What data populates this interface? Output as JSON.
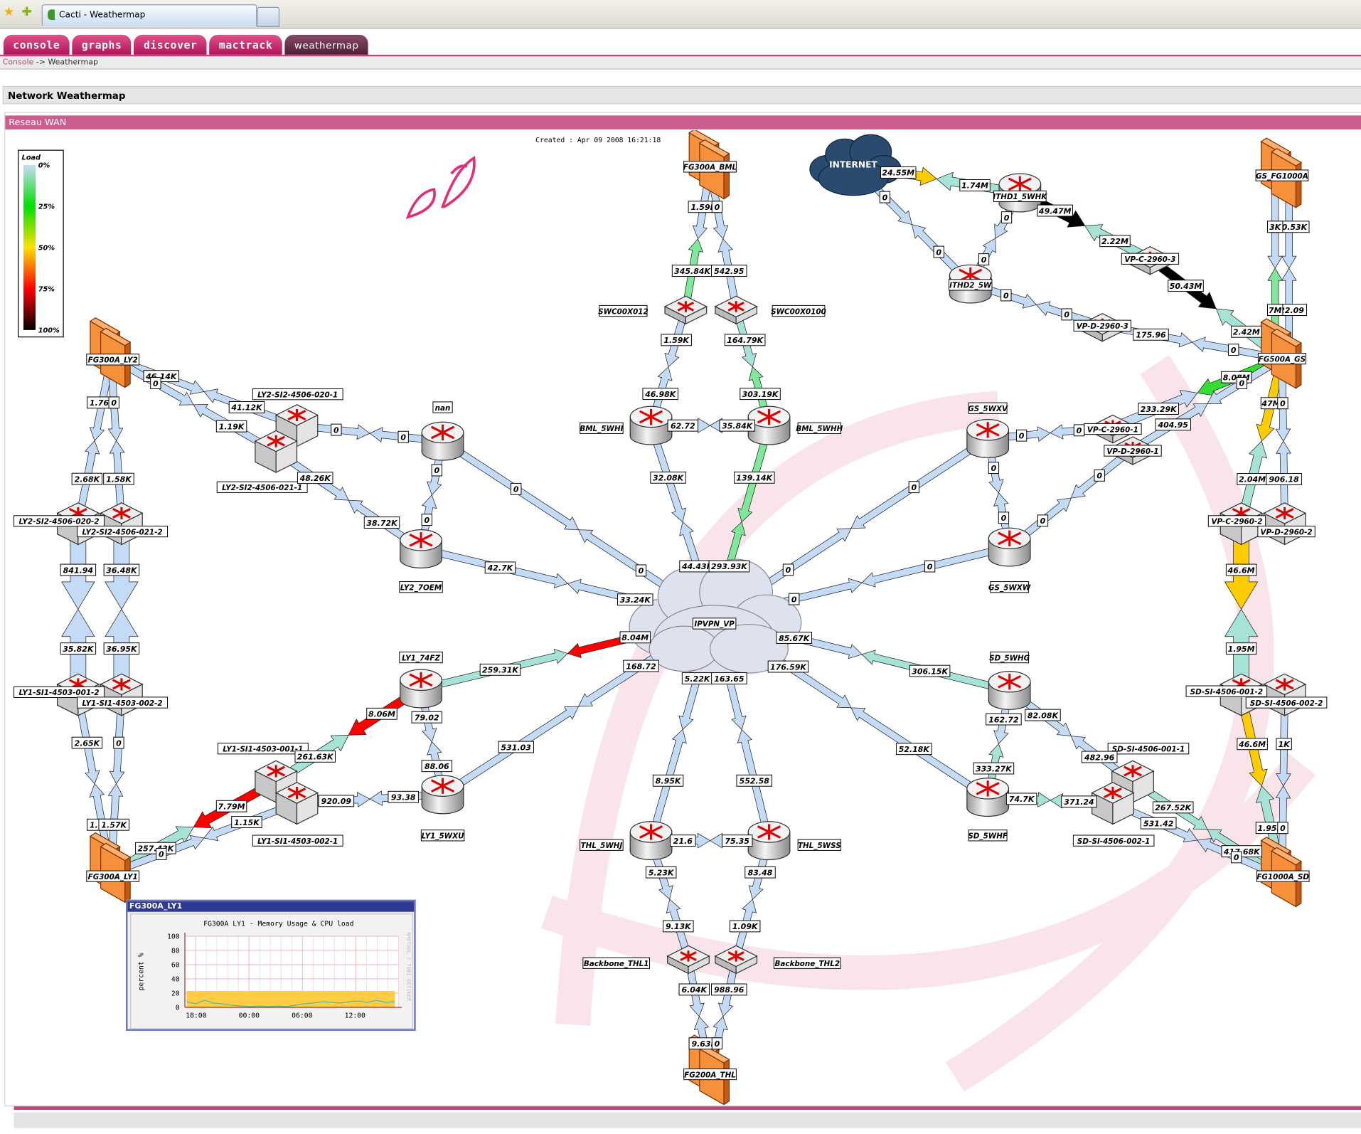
{
  "browser": {
    "tab_title": "Cacti - Weathermap"
  },
  "nav": {
    "tabs": [
      {
        "label": "console"
      },
      {
        "label": "graphs"
      },
      {
        "label": "discover"
      },
      {
        "label": "mactrack"
      },
      {
        "label": "weathermap",
        "active": true
      }
    ]
  },
  "breadcrumb": {
    "root": "Console",
    "separator": " -> ",
    "current": "Weathermap"
  },
  "page": {
    "title": "Network Weathermap",
    "map_title": "Reseau WAN"
  },
  "map": {
    "created": "Created : Apr 09 2008 16:21:18",
    "legend": {
      "title": "Load",
      "stops": [
        "0%",
        "25%",
        "50%",
        "75%",
        "100%"
      ],
      "colors": [
        "#c8dcf8",
        "#00e000",
        "#ffe000",
        "#ff0000",
        "#000000"
      ]
    },
    "colors": {
      "idle": "#c4dbf7",
      "low": "#a6e3d6",
      "green": "#7fe89a",
      "bright_green": "#33dd33",
      "yellow": "#ffcc00",
      "red": "#ff0000",
      "black": "#000000"
    },
    "nodes": [
      {
        "id": "FG300A_BML",
        "type": "firewall"
      },
      {
        "id": "INTERNET",
        "type": "internet"
      },
      {
        "id": "ITHD1_5WHK",
        "type": "router"
      },
      {
        "id": "ITHD2_5W",
        "type": "router"
      },
      {
        "id": "VP-C-2960-3",
        "type": "flatswitch"
      },
      {
        "id": "VP-D-2960-3",
        "type": "flatswitch"
      },
      {
        "id": "GS_FG1000A",
        "type": "firewall"
      },
      {
        "id": "FG500A_GS",
        "type": "firewall"
      },
      {
        "id": "SWC00X012",
        "type": "flatswitch"
      },
      {
        "id": "SWC00X0100",
        "type": "flatswitch"
      },
      {
        "id": "BML_5WHI",
        "type": "router"
      },
      {
        "id": "BML_5WHH",
        "type": "router"
      },
      {
        "id": "GS_5WXV",
        "type": "router"
      },
      {
        "id": "GS_5WXW",
        "type": "router"
      },
      {
        "id": "VP-C-2960-1",
        "type": "flatswitch"
      },
      {
        "id": "VP-D-2960-1",
        "type": "flatswitch"
      },
      {
        "id": "VP-C-2960-2",
        "type": "switch"
      },
      {
        "id": "VP-D-2960-2",
        "type": "switch"
      },
      {
        "id": "IPVPN_VP",
        "type": "cloud"
      },
      {
        "id": "nan",
        "type": "router"
      },
      {
        "id": "LY2_7OEM",
        "type": "router"
      },
      {
        "id": "LY2-SI2-4506-020-1",
        "type": "switch"
      },
      {
        "id": "LY2-SI2-4506-021-1",
        "type": "switch"
      },
      {
        "id": "FG300A_LY2",
        "type": "firewall"
      },
      {
        "id": "LY2-SI2-4506-020-2",
        "type": "switch"
      },
      {
        "id": "LY2-SI2-4506-021-2",
        "type": "switch"
      },
      {
        "id": "LY1-SI1-4503-001-2",
        "type": "switch"
      },
      {
        "id": "LY1-SI1-4503-002-2",
        "type": "switch"
      },
      {
        "id": "FG300A_LY1",
        "type": "firewall"
      },
      {
        "id": "LY1_74FZ",
        "type": "router"
      },
      {
        "id": "LY1_5WXU",
        "type": "router"
      },
      {
        "id": "LY1-SI1-4503-001-1",
        "type": "switch"
      },
      {
        "id": "LY1-SI1-4503-002-1",
        "type": "switch"
      },
      {
        "id": "THL_5WHJ",
        "type": "router"
      },
      {
        "id": "THL_5WSS",
        "type": "router"
      },
      {
        "id": "Backbone_THL1",
        "type": "flatswitch"
      },
      {
        "id": "Backbone_THL2",
        "type": "flatswitch"
      },
      {
        "id": "FG200A_THL",
        "type": "firewall"
      },
      {
        "id": "SD_5WHG",
        "type": "router"
      },
      {
        "id": "SD_5WHF",
        "type": "router"
      },
      {
        "id": "SD-SI-4506-001-1",
        "type": "switch"
      },
      {
        "id": "SD-SI-4506-002-1",
        "type": "switch"
      },
      {
        "id": "SD-SI-4506-001-2",
        "type": "switch"
      },
      {
        "id": "SD-SI-4506-002-2",
        "type": "switch"
      },
      {
        "id": "FG1000A_SD",
        "type": "firewall"
      }
    ],
    "links": [
      {
        "a": "FG300A_BML",
        "b": "SWC00X012",
        "la": "1.59K",
        "lb": "345.84K",
        "ca": "idle",
        "cb": "green"
      },
      {
        "a": "FG300A_BML",
        "b": "SWC00X0100",
        "la": "0",
        "lb": "542.95",
        "ca": "idle",
        "cb": "idle"
      },
      {
        "a": "SWC00X012",
        "b": "BML_5WHI",
        "la": "1.59K",
        "lb": "46.98K",
        "ca": "idle",
        "cb": "idle"
      },
      {
        "a": "SWC00X0100",
        "b": "BML_5WHH",
        "la": "164.79K",
        "lb": "303.19K",
        "ca": "low",
        "cb": "green"
      },
      {
        "a": "BML_5WHI",
        "b": "BML_5WHH",
        "la": "62.72",
        "lb": "35.84K",
        "ca": "idle",
        "cb": "idle"
      },
      {
        "a": "BML_5WHI",
        "b": "IPVPN_VP",
        "la": "32.08K",
        "lb": "44.43K",
        "ca": "idle",
        "cb": "idle"
      },
      {
        "a": "BML_5WHH",
        "b": "IPVPN_VP",
        "la": "139.14K",
        "lb": "293.93K",
        "ca": "green",
        "cb": "green"
      },
      {
        "a": "INTERNET",
        "b": "ITHD1_5WHK",
        "la": "24.55M",
        "lb": "1.74M",
        "ca": "yellow",
        "cb": "low"
      },
      {
        "a": "INTERNET",
        "b": "ITHD2_5W",
        "la": "0",
        "lb": "0",
        "ca": "idle",
        "cb": "idle"
      },
      {
        "a": "ITHD1_5WHK",
        "b": "ITHD2_5W",
        "la": "0",
        "lb": "0",
        "ca": "idle",
        "cb": "idle"
      },
      {
        "a": "ITHD1_5WHK",
        "b": "VP-C-2960-3",
        "la": "49.47M",
        "lb": "2.22M",
        "ca": "black",
        "cb": "low"
      },
      {
        "a": "VP-C-2960-3",
        "b": "FG500A_GS",
        "la": "50.43M",
        "lb": "2.42M",
        "ca": "black",
        "cb": "low"
      },
      {
        "a": "ITHD2_5W",
        "b": "VP-D-2960-3",
        "la": "0",
        "lb": "0",
        "ca": "idle",
        "cb": "idle"
      },
      {
        "a": "VP-D-2960-3",
        "b": "FG500A_GS",
        "la": "175.96",
        "lb": "0",
        "ca": "idle",
        "cb": "idle"
      },
      {
        "a": "GS_FG1000A",
        "b": "FG500A_GS",
        "la": "200.53K",
        "lb": "522.09",
        "ca": "idle",
        "cb": "idle",
        "lane": -1
      },
      {
        "a": "GS_FG1000A",
        "b": "FG500A_GS",
        "la": "3K",
        "lb": "7M",
        "ca": "idle",
        "cb": "green",
        "lane": 1
      },
      {
        "a": "FG500A_GS",
        "b": "VP-C-2960-1",
        "la": "8.08M",
        "lb": "233.29K",
        "ca": "bright_green",
        "cb": "idle"
      },
      {
        "a": "FG500A_GS",
        "b": "VP-D-2960-1",
        "la": "0",
        "lb": "404.95",
        "ca": "idle",
        "cb": "idle"
      },
      {
        "a": "GS_5WXV",
        "b": "VP-C-2960-1",
        "la": "0",
        "lb": "0",
        "ca": "idle",
        "cb": "idle"
      },
      {
        "a": "GS_5WXV",
        "b": "GS_5WXW",
        "la": "0",
        "lb": "0",
        "ca": "idle",
        "cb": "idle"
      },
      {
        "a": "GS_5WXW",
        "b": "VP-D-2960-1",
        "la": "0",
        "lb": "0",
        "ca": "idle",
        "cb": "idle"
      },
      {
        "a": "GS_5WXV",
        "b": "IPVPN_VP",
        "la": "0",
        "lb": "0",
        "ca": "idle",
        "cb": "idle"
      },
      {
        "a": "GS_5WXW",
        "b": "IPVPN_VP",
        "la": "0",
        "lb": "0",
        "ca": "idle",
        "cb": "idle"
      },
      {
        "a": "FG500A_GS",
        "b": "VP-C-2960-2",
        "la": "47M",
        "lb": "2.04M",
        "ca": "yellow",
        "cb": "low"
      },
      {
        "a": "FG500A_GS",
        "b": "VP-D-2960-2",
        "la": "0",
        "lb": "906.18",
        "ca": "idle",
        "cb": "idle"
      },
      {
        "a": "VP-C-2960-2",
        "b": "SD-SI-4506-001-2",
        "la": "46.6M",
        "lb": "1.95M",
        "ca": "yellow",
        "cb": "low",
        "wide": true
      },
      {
        "a": "SD-SI-4506-001-2",
        "b": "FG1000A_SD",
        "la": "46.6M",
        "lb": "1.95M",
        "ca": "yellow",
        "cb": "low"
      },
      {
        "a": "SD-SI-4506-002-2",
        "b": "FG1000A_SD",
        "la": "1K",
        "lb": "0",
        "ca": "idle",
        "cb": "idle"
      },
      {
        "a": "SD_5WHG",
        "b": "IPVPN_VP",
        "la": "306.15K",
        "lb": "85.67K",
        "ca": "low",
        "cb": "idle"
      },
      {
        "a": "SD_5WHG",
        "b": "SD_5WHF",
        "la": "162.72",
        "lb": "333.27K",
        "ca": "idle",
        "cb": "low"
      },
      {
        "a": "SD_5WHG",
        "b": "SD-SI-4506-001-1",
        "la": "82.08K",
        "lb": "482.96",
        "ca": "idle",
        "cb": "idle"
      },
      {
        "a": "SD_5WHF",
        "b": "SD-SI-4506-002-1",
        "la": "74.7K",
        "lb": "371.24",
        "ca": "low",
        "cb": "low"
      },
      {
        "a": "SD_5WHF",
        "b": "IPVPN_VP",
        "la": "52.18K",
        "lb": "176.59K",
        "ca": "idle",
        "cb": "idle"
      },
      {
        "a": "SD-SI-4506-001-1",
        "b": "FG1000A_SD",
        "la": "267.52K",
        "lb": "417.68K",
        "ca": "low",
        "cb": "low"
      },
      {
        "a": "SD-SI-4506-002-1",
        "b": "FG1000A_SD",
        "la": "531.42",
        "lb": "0",
        "ca": "idle",
        "cb": "idle"
      },
      {
        "a": "THL_5WHJ",
        "b": "IPVPN_VP",
        "la": "8.95K",
        "lb": "5.22K",
        "ca": "idle",
        "cb": "idle"
      },
      {
        "a": "THL_5WSS",
        "b": "IPVPN_VP",
        "la": "552.58",
        "lb": "163.65",
        "ca": "idle",
        "cb": "idle"
      },
      {
        "a": "THL_5WHJ",
        "b": "THL_5WSS",
        "la": "21.6",
        "lb": "75.35",
        "ca": "idle",
        "cb": "idle"
      },
      {
        "a": "THL_5WHJ",
        "b": "Backbone_THL1",
        "la": "5.23K",
        "lb": "9.13K",
        "ca": "idle",
        "cb": "idle"
      },
      {
        "a": "THL_5WSS",
        "b": "Backbone_THL2",
        "la": "83.48",
        "lb": "1.09K",
        "ca": "idle",
        "cb": "idle"
      },
      {
        "a": "Backbone_THL1",
        "b": "FG200A_THL",
        "la": "6.04K",
        "lb": "9.63K",
        "ca": "idle",
        "cb": "idle"
      },
      {
        "a": "Backbone_THL2",
        "b": "FG200A_THL",
        "la": "988.96",
        "lb": "0",
        "ca": "idle",
        "cb": "idle"
      },
      {
        "a": "LY1_5WXU",
        "b": "IPVPN_VP",
        "la": "531.03",
        "lb": "168.72",
        "ca": "idle",
        "cb": "idle"
      },
      {
        "a": "LY1_74FZ",
        "b": "IPVPN_VP",
        "la": "259.31K",
        "lb": "8.04M",
        "ca": "low",
        "cb": "red"
      },
      {
        "a": "LY1_74FZ",
        "b": "LY1_5WXU",
        "la": "79.02",
        "lb": "88.06",
        "ca": "idle",
        "cb": "idle"
      },
      {
        "a": "LY1_74FZ",
        "b": "LY1-SI1-4503-001-1",
        "la": "8.06M",
        "lb": "261.63K",
        "ca": "red",
        "cb": "low"
      },
      {
        "a": "LY1_5WXU",
        "b": "LY1-SI1-4503-002-1",
        "la": "93.38",
        "lb": "920.09",
        "ca": "idle",
        "cb": "idle"
      },
      {
        "a": "LY1-SI1-4503-001-1",
        "b": "FG300A_LY1",
        "la": "7.79M",
        "lb": "257.43K",
        "ca": "red",
        "cb": "low"
      },
      {
        "a": "LY1-SI1-4503-002-1",
        "b": "FG300A_LY1",
        "la": "1.15K",
        "lb": "0",
        "ca": "idle",
        "cb": "idle"
      },
      {
        "a": "LY1-SI1-4503-001-2",
        "b": "FG300A_LY1",
        "la": "2.65K",
        "lb": "1.79K",
        "ca": "idle",
        "cb": "idle"
      },
      {
        "a": "LY1-SI1-4503-002-2",
        "b": "FG300A_LY1",
        "la": "0",
        "lb": "1.57K",
        "ca": "idle",
        "cb": "idle"
      },
      {
        "a": "LY2-SI2-4506-020-2",
        "b": "LY1-SI1-4503-001-2",
        "la": "841.94",
        "lb": "35.82K",
        "ca": "idle",
        "cb": "idle",
        "wide": true
      },
      {
        "a": "LY2-SI2-4506-021-2",
        "b": "LY1-SI1-4503-002-2",
        "la": "36.48K",
        "lb": "36.95K",
        "ca": "idle",
        "cb": "idle",
        "wide": true
      },
      {
        "a": "FG300A_LY2",
        "b": "LY2-SI2-4506-020-2",
        "la": "1.76K",
        "lb": "2.68K",
        "ca": "idle",
        "cb": "idle"
      },
      {
        "a": "FG300A_LY2",
        "b": "LY2-SI2-4506-021-2",
        "la": "0",
        "lb": "1.58K",
        "ca": "idle",
        "cb": "idle"
      },
      {
        "a": "FG300A_LY2",
        "b": "LY2-SI2-4506-020-1",
        "la": "46.14K",
        "lb": "41.12K",
        "ca": "idle",
        "cb": "idle"
      },
      {
        "a": "FG300A_LY2",
        "b": "LY2-SI2-4506-021-1",
        "la": "0",
        "lb": "1.19K",
        "ca": "idle",
        "cb": "idle"
      },
      {
        "a": "LY2-SI2-4506-020-1",
        "b": "nan",
        "la": "0",
        "lb": "0",
        "ca": "idle",
        "cb": "idle"
      },
      {
        "a": "LY2-SI2-4506-021-1",
        "b": "LY2_7OEM",
        "la": "48.26K",
        "lb": "38.72K",
        "ca": "idle",
        "cb": "idle"
      },
      {
        "a": "nan",
        "b": "LY2_7OEM",
        "la": "0",
        "lb": "0",
        "ca": "idle",
        "cb": "idle"
      },
      {
        "a": "nan",
        "b": "IPVPN_VP",
        "la": "0",
        "lb": "0",
        "ca": "idle",
        "cb": "idle"
      },
      {
        "a": "LY2_7OEM",
        "b": "IPVPN_VP",
        "la": "42.7K",
        "lb": "33.24K",
        "ca": "idle",
        "cb": "idle"
      }
    ]
  },
  "popup": {
    "title": "FG300A_LY1",
    "watermark": "RRDTOOL / TOBI OETIKER"
  },
  "chart_data": {
    "type": "area",
    "title": "FG300A LY1 - Memory Usage & CPU load",
    "ylabel": "percent %",
    "xlabel": "",
    "ylim": [
      0,
      100
    ],
    "yticks": [
      "100",
      "80",
      "60",
      "40",
      "20",
      "0"
    ],
    "xticks": [
      "18:00",
      "00:00",
      "06:00",
      "12:00"
    ],
    "grid": true,
    "series": [
      {
        "values": [
          23,
          23,
          23,
          23,
          23,
          23,
          23,
          23,
          23,
          23,
          23,
          23,
          23,
          23,
          23,
          23,
          23,
          23,
          23,
          23,
          23,
          23,
          23,
          23
        ],
        "color": "#ffcc44"
      },
      {
        "values": [
          8,
          5,
          10,
          6,
          5,
          3,
          2,
          1,
          2,
          1,
          2,
          1,
          3,
          5,
          6,
          8,
          7,
          6,
          8,
          9,
          7,
          10,
          7,
          8
        ],
        "color": "#55bb99"
      }
    ]
  }
}
